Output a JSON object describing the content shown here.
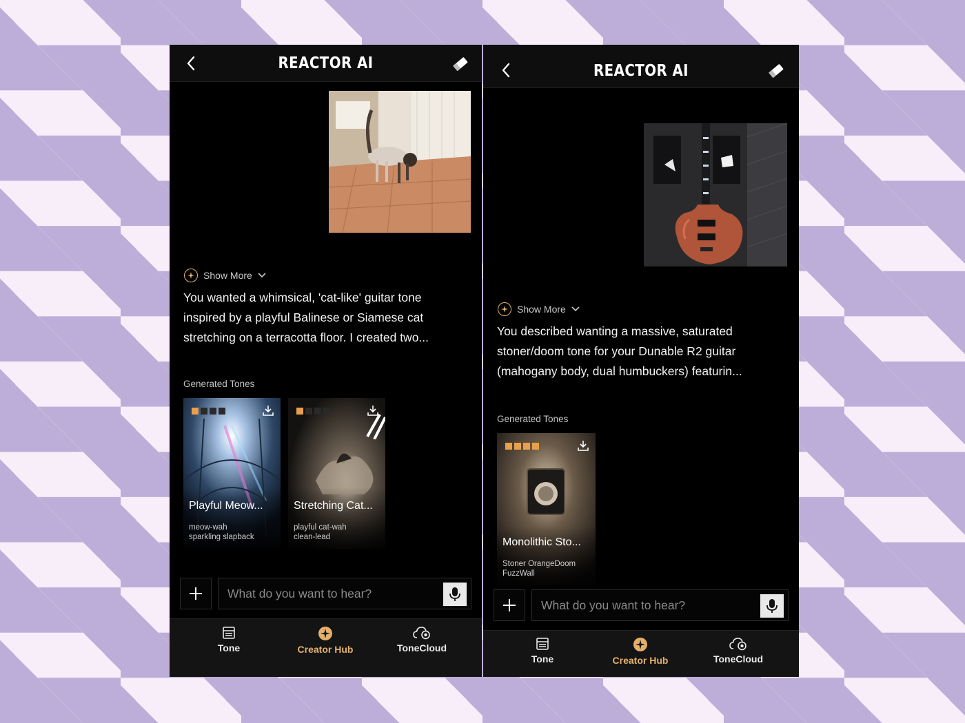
{
  "screens": [
    {
      "header": {
        "title": "REACTOR AI",
        "back_icon": "chevron-left-icon",
        "eraser_icon": "eraser-icon"
      },
      "photo": {
        "subject": "cat-photo"
      },
      "show_more": "Show More",
      "summary": "You wanted a whimsical, 'cat-like' guitar tone inspired by a playful Balinese or Siamese cat stretching on a terracotta floor. I created two...",
      "generated_label": "Generated Tones",
      "tones": [
        {
          "name": "Playful Meow...",
          "tag_line1": "meow-wah",
          "tag_line2": "sparkling  slapback",
          "level": 1
        },
        {
          "name": "Stretching Cat...",
          "tag_line1": "playful  cat-wah",
          "tag_line2": "clean-lead",
          "level": 1
        }
      ],
      "input": {
        "placeholder": "What do you want to hear?"
      },
      "tabs": [
        {
          "label": "Tone",
          "icon": "amp-icon"
        },
        {
          "label": "Creator Hub",
          "icon": "sparkle-icon",
          "active": true
        },
        {
          "label": "ToneCloud",
          "icon": "cloud-icon"
        }
      ]
    },
    {
      "header": {
        "title": "REACTOR AI",
        "back_icon": "chevron-left-icon",
        "eraser_icon": "eraser-icon"
      },
      "photo": {
        "subject": "guitar-photo"
      },
      "show_more": "Show More",
      "summary": "You described wanting a massive, saturated stoner/doom tone for your Dunable R2 guitar (mahogany body, dual humbuckers) featurin...",
      "generated_label": "Generated Tones",
      "tones": [
        {
          "name": "Monolithic Sto...",
          "tag_line1": "Stoner  OrangeDoom",
          "tag_line2": "FuzzWall",
          "level": 4
        }
      ],
      "input": {
        "placeholder": "What do you want to hear?"
      },
      "tabs": [
        {
          "label": "Tone",
          "icon": "amp-icon"
        },
        {
          "label": "Creator Hub",
          "icon": "sparkle-icon",
          "active": true
        },
        {
          "label": "ToneCloud",
          "icon": "cloud-icon"
        }
      ]
    }
  ],
  "colors": {
    "accent": "#e4b06a",
    "led_on": "#e8a04a",
    "background": "#000000",
    "checker_dark": "#bcaed8",
    "checker_light": "#f7eefa"
  }
}
